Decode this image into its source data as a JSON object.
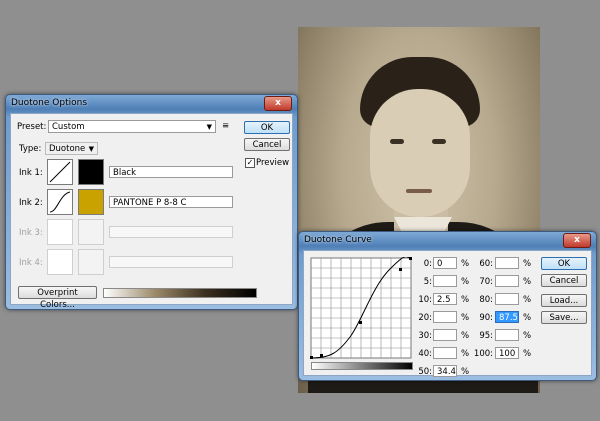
{
  "duotone_options": {
    "title": "Duotone Options",
    "close": "x",
    "preset_label": "Preset:",
    "preset_value": "Custom",
    "preset_menu_icon": "≡",
    "type_label": "Type:",
    "type_value": "Duotone",
    "ok": "OK",
    "cancel": "Cancel",
    "preview_label": "Preview",
    "preview_checked": true,
    "inks": [
      {
        "label": "Ink 1:",
        "name": "Black",
        "color": "#000000",
        "enabled": true
      },
      {
        "label": "Ink 2:",
        "name": "PANTONE P 8-8 C",
        "color": "#c9a200",
        "enabled": true
      },
      {
        "label": "Ink 3:",
        "name": "",
        "color": "#ffffff",
        "enabled": false
      },
      {
        "label": "Ink 4:",
        "name": "",
        "color": "#ffffff",
        "enabled": false
      }
    ],
    "overprint_button": "Overprint Colors..."
  },
  "duotone_curve": {
    "title": "Duotone Curve",
    "close": "x",
    "ok": "OK",
    "cancel": "Cancel",
    "load": "Load...",
    "save": "Save...",
    "percent": "%",
    "left_col": [
      {
        "label": "0:",
        "value": "0"
      },
      {
        "label": "5:",
        "value": ""
      },
      {
        "label": "10:",
        "value": "2.5"
      },
      {
        "label": "20:",
        "value": ""
      },
      {
        "label": "30:",
        "value": ""
      },
      {
        "label": "40:",
        "value": ""
      },
      {
        "label": "50:",
        "value": "34.4"
      }
    ],
    "right_col": [
      {
        "label": "60:",
        "value": ""
      },
      {
        "label": "70:",
        "value": ""
      },
      {
        "label": "80:",
        "value": ""
      },
      {
        "label": "90:",
        "value": "87.5"
      },
      {
        "label": "95:",
        "value": ""
      },
      {
        "label": "100:",
        "value": "100"
      }
    ]
  }
}
